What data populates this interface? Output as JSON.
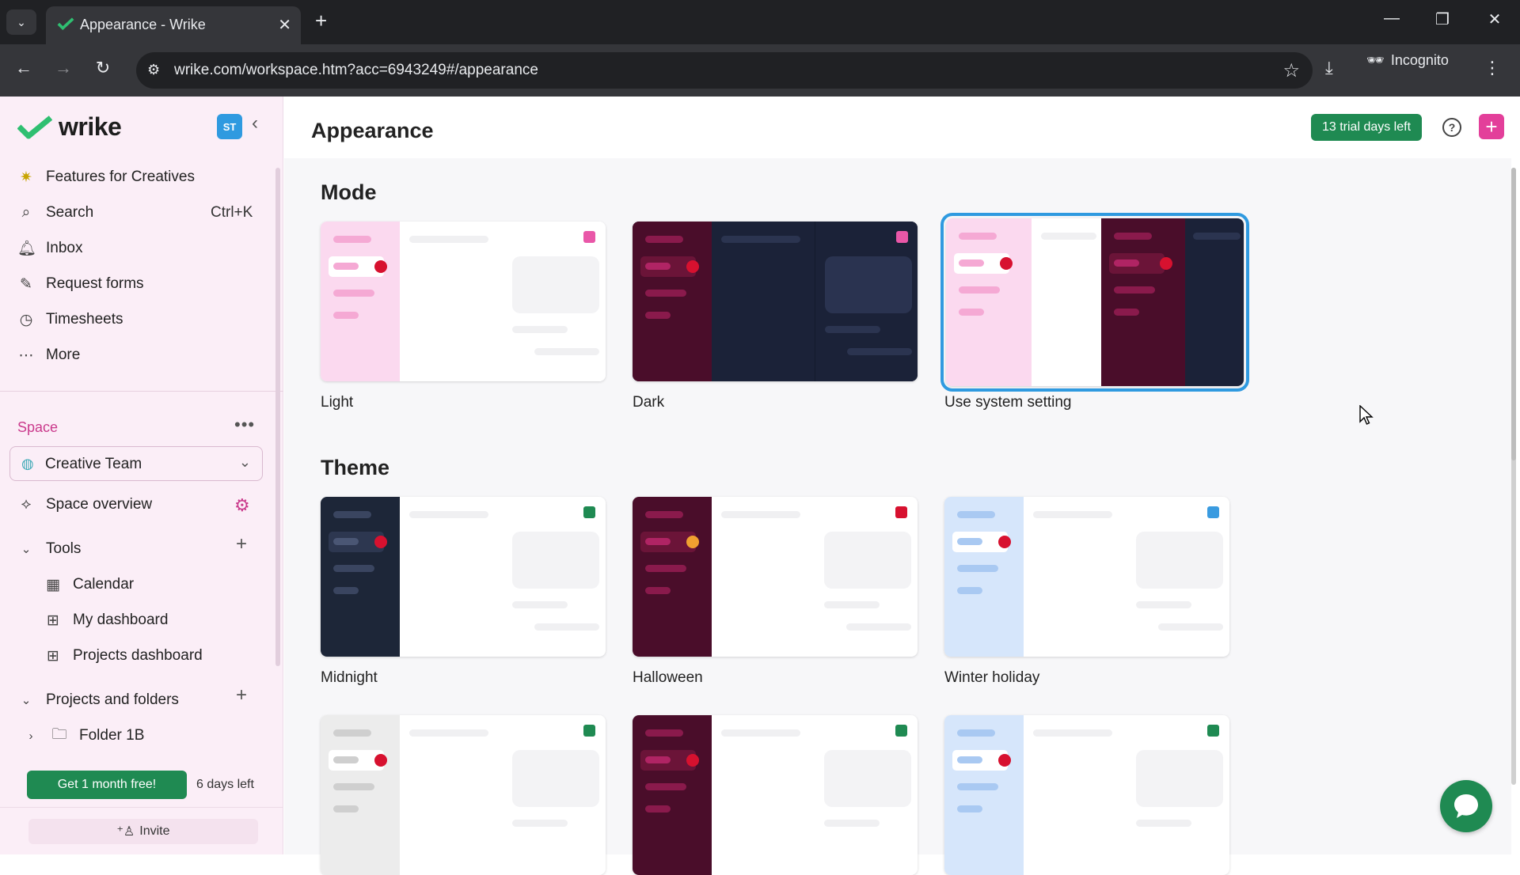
{
  "browser": {
    "tab_title": "Appearance - Wrike",
    "url": "wrike.com/workspace.htm?acc=6943249#/appearance",
    "incognito_label": "Incognito"
  },
  "sidebar": {
    "logo": "wrike",
    "avatar_initials": "ST",
    "nav": [
      {
        "label": "Features for Creatives",
        "icon": "sparkle-icon"
      },
      {
        "label": "Search",
        "icon": "search-icon",
        "shortcut": "Ctrl+K"
      },
      {
        "label": "Inbox",
        "icon": "bell-icon"
      },
      {
        "label": "Request forms",
        "icon": "form-icon"
      },
      {
        "label": "Timesheets",
        "icon": "clock-icon"
      },
      {
        "label": "More",
        "icon": "more-icon"
      }
    ],
    "space_label": "Space",
    "space_name": "Creative Team",
    "space_overview": "Space overview",
    "tools_label": "Tools",
    "tools": [
      {
        "label": "Calendar"
      },
      {
        "label": "My dashboard"
      },
      {
        "label": "Projects dashboard"
      }
    ],
    "projects_label": "Projects and folders",
    "folder": "Folder 1B",
    "promo_button": "Get 1 month free!",
    "days_left": "6 days left",
    "invite": "Invite"
  },
  "header": {
    "title": "Appearance",
    "trial_badge": "13 trial days left"
  },
  "mode": {
    "heading": "Mode",
    "options": [
      {
        "label": "Light"
      },
      {
        "label": "Dark"
      },
      {
        "label": "Use system setting",
        "selected": true
      }
    ]
  },
  "theme": {
    "heading": "Theme",
    "options": [
      {
        "label": "Midnight"
      },
      {
        "label": "Halloween"
      },
      {
        "label": "Winter holiday"
      }
    ]
  },
  "colors": {
    "accent": "#e33f9a",
    "green": "#1f8a52",
    "selection": "#2f9ae0",
    "dark_sidebar": "#4a0d2a",
    "dark_main": "#1b2238",
    "midnight": "#1d2638",
    "winter": "#d6e6fb"
  }
}
